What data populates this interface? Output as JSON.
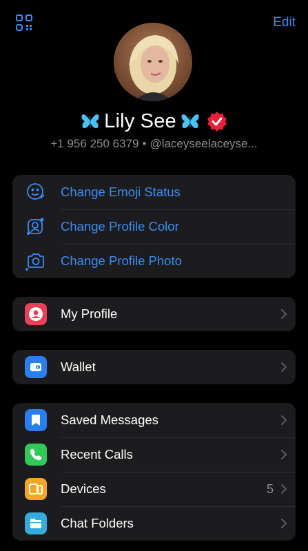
{
  "header": {
    "edit_label": "Edit",
    "qr_icon": "qr-code-icon"
  },
  "profile": {
    "name": "Lily See",
    "phone": "+1 956 250 6379",
    "separator": "•",
    "username": "@laceyseelaceyse...",
    "verified": true
  },
  "status_group": [
    {
      "label": "Change Emoji Status",
      "icon": "emoji-status-icon"
    },
    {
      "label": "Change Profile Color",
      "icon": "profile-color-icon"
    },
    {
      "label": "Change Profile Photo",
      "icon": "camera-icon"
    }
  ],
  "profile_group": [
    {
      "label": "My Profile",
      "icon": "person-icon",
      "color": "#eb3e59"
    }
  ],
  "wallet_group": [
    {
      "label": "Wallet",
      "icon": "wallet-icon",
      "color": "#2a7ff0"
    }
  ],
  "main_group": [
    {
      "label": "Saved Messages",
      "icon": "bookmark-icon",
      "color": "#2a7ff0"
    },
    {
      "label": "Recent Calls",
      "icon": "phone-icon",
      "color": "#34c759"
    },
    {
      "label": "Devices",
      "icon": "devices-icon",
      "color": "#f5a623",
      "count": "5"
    },
    {
      "label": "Chat Folders",
      "icon": "folder-icon",
      "color": "#35aadc"
    }
  ],
  "colors": {
    "accent": "#3b8cf5",
    "background": "#000000",
    "group_background": "#1c1c1e",
    "secondary_text": "#8d8d93",
    "verified_badge": "#e8203a"
  }
}
